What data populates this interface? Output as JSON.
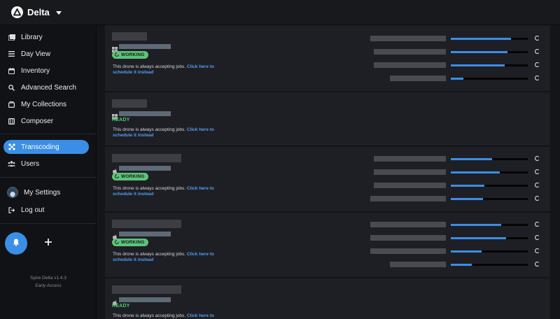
{
  "app": {
    "name": "Delta",
    "version": "Spire Delta v1.4.3",
    "access": "Early Access"
  },
  "sidebar": {
    "items": [
      {
        "label": "Library",
        "icon": "library-icon"
      },
      {
        "label": "Day View",
        "icon": "list-icon"
      },
      {
        "label": "Inventory",
        "icon": "calendar-icon"
      },
      {
        "label": "Advanced Search",
        "icon": "search-icon"
      },
      {
        "label": "My Collections",
        "icon": "collection-icon"
      },
      {
        "label": "Composer",
        "icon": "film-icon"
      },
      {
        "label": "Transcoding",
        "icon": "drone-icon",
        "active": true
      },
      {
        "label": "Users",
        "icon": "users-icon"
      },
      {
        "label": "My Settings",
        "icon": "avatar"
      },
      {
        "label": "Log out",
        "icon": "logout-icon"
      }
    ]
  },
  "drones": [
    {
      "os": "windows-icon",
      "status": "WORKING",
      "jobs": [
        0.78,
        0.74,
        0.7,
        0.16
      ]
    },
    {
      "os": "windows-icon",
      "status": "READY",
      "jobs": []
    },
    {
      "os": "apple-icon",
      "status": "WORKING",
      "jobs": [
        0.54,
        0.64,
        0.44,
        0.42
      ]
    },
    {
      "os": "apple-icon",
      "status": "WORKING",
      "jobs": [
        0.65,
        0.72,
        0.4,
        0.27
      ]
    },
    {
      "os": "apple-icon",
      "status": "READY",
      "jobs": []
    }
  ],
  "drone_text": {
    "description": "This drone is always accepting jobs.",
    "link": "Click here to schedule it instead"
  },
  "colors": {
    "accent": "#3a8ee6",
    "working": "#5ec27a",
    "ready": "#59c777"
  }
}
